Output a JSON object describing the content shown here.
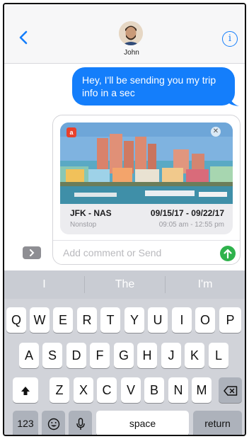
{
  "header": {
    "contact_name": "John",
    "info_glyph": "i",
    "back_icon": "chevron-left-icon"
  },
  "messages": [
    {
      "direction": "outgoing",
      "text": "Hey, I'll be sending you my trip info in a sec"
    }
  ],
  "trip_card": {
    "app_badge": "a",
    "route": "JFK - NAS",
    "dates": "09/15/17 - 09/22/17",
    "stops": "Nonstop",
    "times": "09:05 am - 12:55 pm"
  },
  "compose": {
    "placeholder": "Add comment or Send"
  },
  "keyboard": {
    "predictions": [
      "I",
      "The",
      "I'm"
    ],
    "row1": [
      "Q",
      "W",
      "E",
      "R",
      "T",
      "Y",
      "U",
      "I",
      "O",
      "P"
    ],
    "row2": [
      "A",
      "S",
      "D",
      "F",
      "G",
      "H",
      "J",
      "K",
      "L"
    ],
    "row3": [
      "Z",
      "X",
      "C",
      "V",
      "B",
      "N",
      "M"
    ],
    "numbers_label": "123",
    "space_label": "space",
    "return_label": "return"
  },
  "colors": {
    "accent": "#147efb",
    "send": "#2fb24c",
    "keyboard_bg": "#d1d3d9"
  }
}
